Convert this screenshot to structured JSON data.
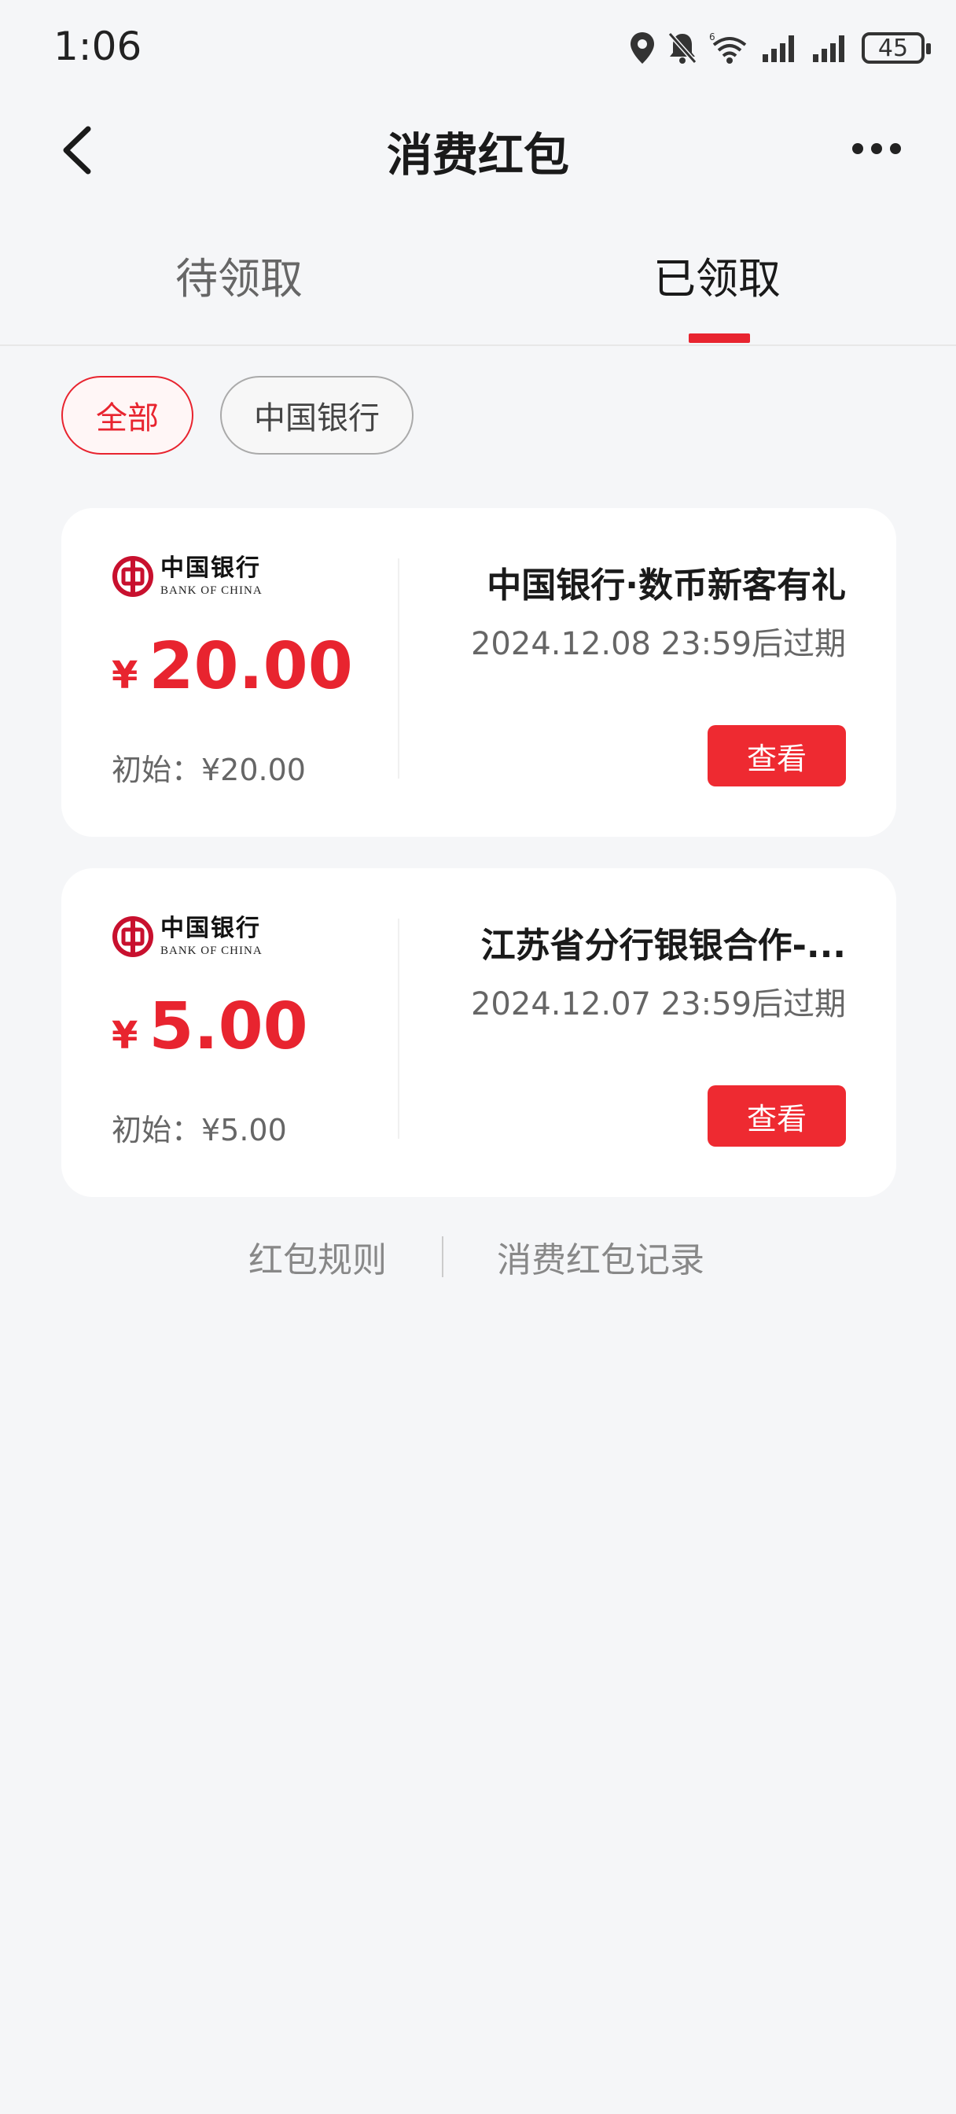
{
  "status_bar": {
    "time": "1:06",
    "battery": "45"
  },
  "header": {
    "title": "消费红包"
  },
  "tabs": [
    {
      "label": "待领取"
    },
    {
      "label": "已领取"
    }
  ],
  "filters": [
    {
      "label": "全部"
    },
    {
      "label": "中国银行"
    }
  ],
  "bank_logo": {
    "name_cn": "中国银行",
    "name_en": "BANK OF CHINA"
  },
  "cards": [
    {
      "currency": "¥",
      "amount": "20.00",
      "initial": "初始：¥20.00",
      "title": "中国银行·数币新客有礼",
      "expiry": "2024.12.08 23:59后过期",
      "button": "查看"
    },
    {
      "currency": "¥",
      "amount": "5.00",
      "initial": "初始：¥5.00",
      "title": "江苏省分行银银合作-...",
      "expiry": "2024.12.07 23:59后过期",
      "button": "查看"
    }
  ],
  "footer": {
    "rules": "红包规则",
    "records": "消费红包记录"
  },
  "colors": {
    "accent": "#e8242f",
    "background": "#f5f6f8",
    "card": "#ffffff"
  }
}
